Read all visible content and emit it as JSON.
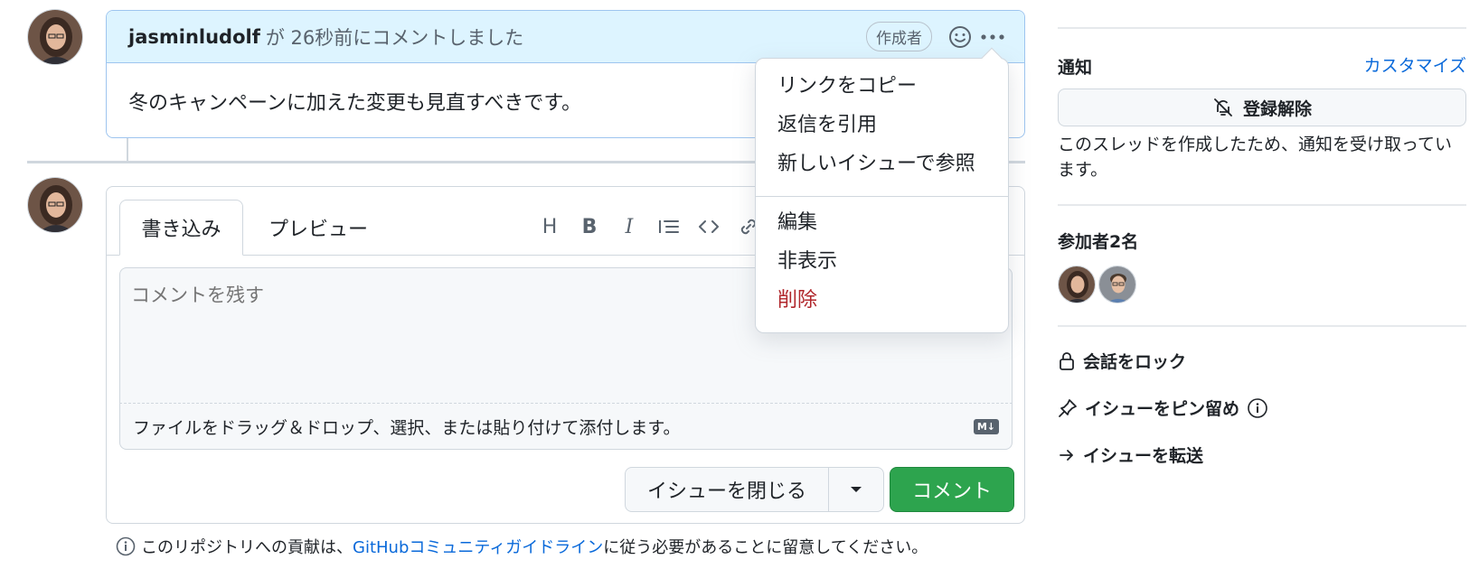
{
  "comment": {
    "author": "jasminludolf",
    "meta": "が 26秒前にコメントしました",
    "badge": "作成者",
    "body": "冬のキャンペーンに加えた変更も見直すべきです。"
  },
  "editor": {
    "tab_write": "書き込み",
    "tab_preview": "プレビュー",
    "toolbar": [
      "H",
      "B",
      "I"
    ],
    "placeholder": "コメントを残す",
    "dropzone": "ファイルをドラッグ＆ドロップ、選択、または貼り付けて添付します。",
    "md_badge": "M↓",
    "close_button": "イシューを閉じる",
    "comment_button": "コメント"
  },
  "footer": {
    "prefix": "このリポジトリへの貢献は、",
    "link": "GitHubコミュニティガイドライン",
    "suffix": "に従う必要があることに留意してください。"
  },
  "menu": {
    "items": [
      "リンクをコピー",
      "返信を引用",
      "新しいイシューで参照",
      "編集",
      "非表示",
      "削除"
    ]
  },
  "sidebar": {
    "notifications_heading": "通知",
    "customize_link": "カスタマイズ",
    "unsubscribe_button": "登録解除",
    "notification_text": "このスレッドを作成したため、通知を受け取っています。",
    "participants_heading": "参加者2名",
    "lock": "会話をロック",
    "pin": "イシューをピン留め",
    "transfer": "イシューを転送"
  },
  "colors": {
    "accent": "#0969da",
    "comment_header_bg": "#ddf4ff",
    "comment_button": "#2da44e",
    "danger": "#b0262b"
  }
}
